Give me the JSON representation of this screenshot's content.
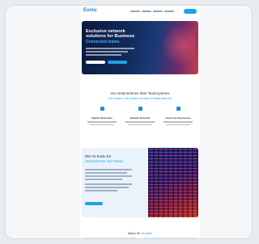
{
  "nav": {
    "logo": "Evolu",
    "links": [
      "",
      "",
      "",
      ""
    ],
    "cta": ""
  },
  "hero": {
    "title": "Exclusive network solutions for Business",
    "accent": "Connected teams",
    "lines": [
      "",
      "",
      ""
    ],
    "buttons": [
      "",
      ""
    ]
  },
  "services": {
    "title": "Von Unternehmen über Teamsysteme",
    "subtitle": "Die Daten, die einen Kunden Infrastrukturen",
    "features": [
      {
        "title": "Digitale Infrastruktur",
        "icon": "box-icon"
      },
      {
        "title": "Netzwerk-Sicherheit",
        "icon": "lock-icon"
      },
      {
        "title": "Cloud & Hosting Services",
        "icon": "cloud-icon"
      }
    ]
  },
  "about": {
    "title": "Wer ist Evolu für",
    "accent": "Unternehmen und Teams",
    "button": ""
  },
  "team": {
    "title": "Sales für",
    "accent": "Kunden"
  },
  "colors": {
    "accent": "#1aa3e8",
    "brand": "#1e7fd8",
    "hero_dark": "#0b1a3d"
  }
}
